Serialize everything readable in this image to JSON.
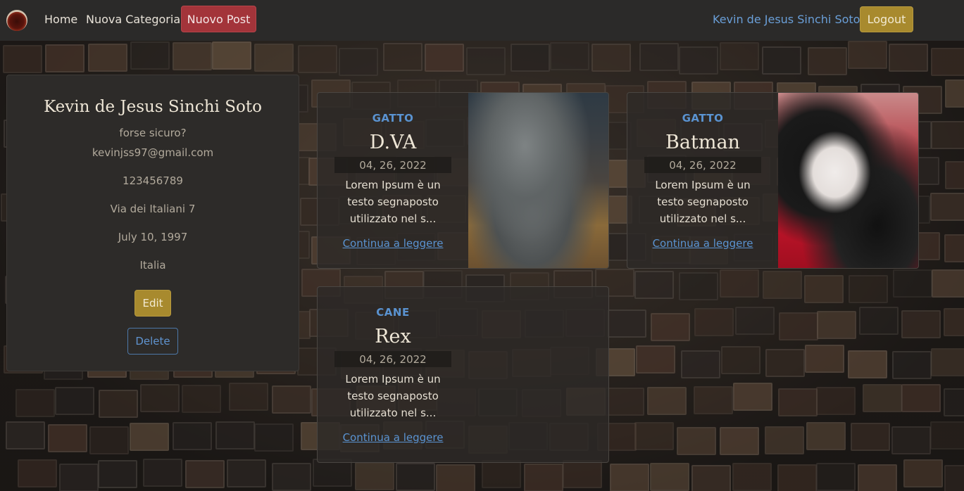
{
  "navbar": {
    "logo_icon": "avatar-logo-icon",
    "home_label": "Home",
    "category_label": "Nuova Categoria",
    "new_post_label": "Nuovo Post",
    "user_name": "Kevin de Jesus Sinchi Soto",
    "logout_label": "Logout"
  },
  "profile": {
    "name": "Kevin de Jesus Sinchi Soto",
    "bio": "forse sicuro?",
    "email": "kevinjss97@gmail.com",
    "phone": "123456789",
    "address": "Via dei Italiani 7",
    "birthdate": "July 10, 1997",
    "country": "Italia",
    "edit_label": "Edit",
    "delete_label": "Delete"
  },
  "posts": [
    {
      "category": "GATTO",
      "title": "D.VA",
      "date": "04, 26, 2022",
      "excerpt": "Lorem Ipsum è un testo segnaposto utilizzato nel s...",
      "link": "Continua a leggere",
      "image": "grey-kitten-photo"
    },
    {
      "category": "GATTO",
      "title": "Batman",
      "date": "04, 26, 2022",
      "excerpt": "Lorem Ipsum è un testo segnaposto utilizzato nel s...",
      "link": "Continua a leggere",
      "image": "black-white-kitten-photo"
    },
    {
      "category": "CANE",
      "title": "Rex",
      "date": "04, 26, 2022",
      "excerpt": "Lorem Ipsum è un testo segnaposto utilizzato nel s...",
      "link": "Continua a leggere",
      "image": ""
    }
  ],
  "colors": {
    "navbar_bg": "#2b2a29",
    "new_post_button": "#a3343a",
    "accent_gold": "#a88a2e",
    "link_blue": "#5a93d1"
  }
}
